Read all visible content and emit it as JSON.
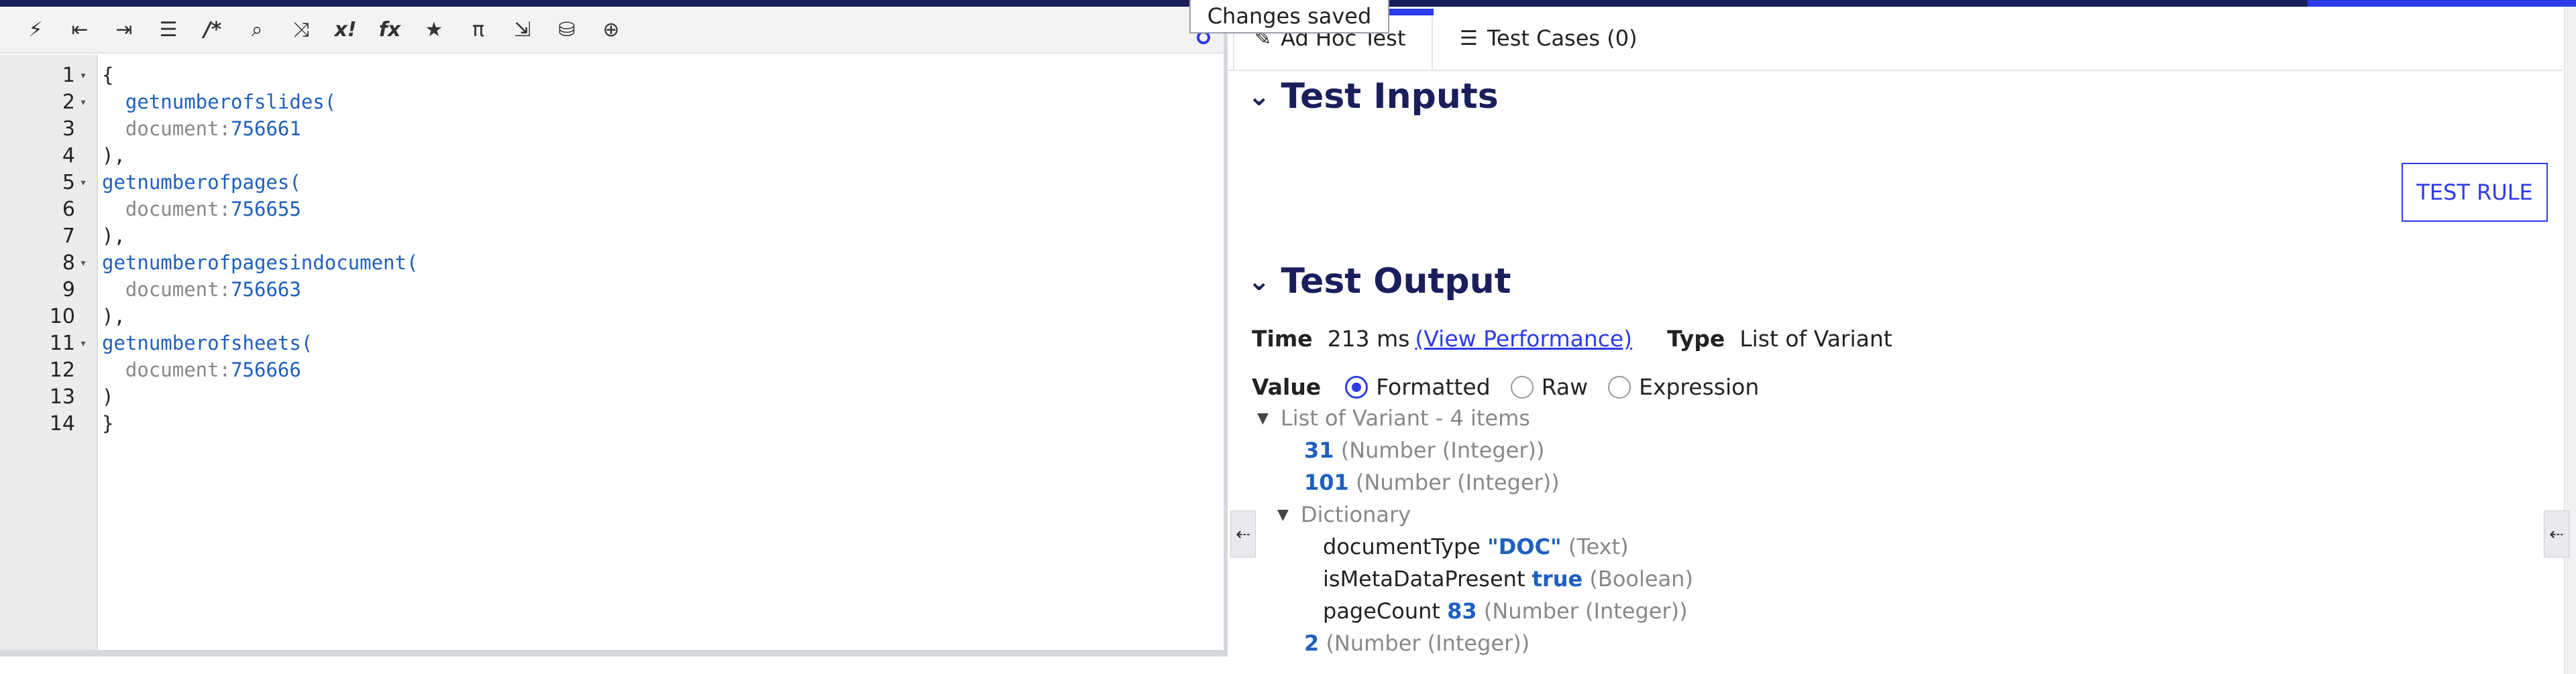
{
  "toast": {
    "text": "Changes saved"
  },
  "toolbar": {
    "icons": [
      {
        "name": "magic-wand-icon",
        "glyph": "⚡"
      },
      {
        "name": "outdent-icon",
        "glyph": "⇤"
      },
      {
        "name": "indent-icon",
        "glyph": "⇥"
      },
      {
        "name": "list-icon",
        "glyph": "☰"
      },
      {
        "name": "comment-icon",
        "glyph": "/*"
      },
      {
        "name": "search-icon",
        "glyph": "⌕"
      },
      {
        "name": "shuffle-icon",
        "glyph": "⤨"
      },
      {
        "name": "clear-icon",
        "glyph": "x!"
      },
      {
        "name": "function-icon",
        "glyph": "fx"
      },
      {
        "name": "star-icon",
        "glyph": "★"
      },
      {
        "name": "pi-icon",
        "glyph": "π"
      },
      {
        "name": "export-icon",
        "glyph": "⇲"
      },
      {
        "name": "database-search-icon",
        "glyph": "⛁"
      },
      {
        "name": "globe-icon",
        "glyph": "⊕"
      }
    ]
  },
  "editor": {
    "lines": [
      {
        "n": "1",
        "fold": "▾",
        "text": "{"
      },
      {
        "n": "2",
        "fold": "▾",
        "indent": "  ",
        "fn": "getnumberofslides",
        "after": "("
      },
      {
        "n": "3",
        "fold": "",
        "indent": "  ",
        "key": "document",
        "sep": ":",
        "num": "756661"
      },
      {
        "n": "4",
        "fold": "",
        "text": "),"
      },
      {
        "n": "5",
        "fold": "▾",
        "fn": "getnumberofpages",
        "after": "("
      },
      {
        "n": "6",
        "fold": "",
        "indent": "  ",
        "key": "document",
        "sep": ":",
        "num": "756655"
      },
      {
        "n": "7",
        "fold": "",
        "text": "),"
      },
      {
        "n": "8",
        "fold": "▾",
        "fn": "getnumberofpagesindocument",
        "after": "("
      },
      {
        "n": "9",
        "fold": "",
        "indent": "  ",
        "key": "document",
        "sep": ":",
        "num": "756663"
      },
      {
        "n": "10",
        "fold": "",
        "text": "),"
      },
      {
        "n": "11",
        "fold": "▾",
        "fn": "getnumberofsheets",
        "after": "("
      },
      {
        "n": "12",
        "fold": "",
        "indent": "  ",
        "key": "document",
        "sep": ":",
        "num": "756666"
      },
      {
        "n": "13",
        "fold": "",
        "text": ")"
      },
      {
        "n": "14",
        "fold": "",
        "text": "}"
      }
    ]
  },
  "tabs": [
    {
      "label": "Ad Hoc Test",
      "icon": "edit-icon",
      "glyph": "✎"
    },
    {
      "label": "Test Cases (0)",
      "icon": "list-icon",
      "glyph": "☰"
    }
  ],
  "test_inputs": {
    "heading": "Test Inputs",
    "chevron": "⌄",
    "button": "TEST RULE"
  },
  "test_output": {
    "heading": "Test Output",
    "chevron": "⌄",
    "time_label": "Time",
    "time_value": "213 ms",
    "view_performance": "(View Performance)",
    "type_label": "Type",
    "type_value": "List of Variant",
    "value_label": "Value",
    "options": [
      "Formatted",
      "Raw",
      "Expression"
    ],
    "selected": "Formatted"
  },
  "result_tree": {
    "root": "List of Variant - 4 items",
    "items": [
      {
        "value": "31",
        "type": " (Number (Integer))"
      },
      {
        "value": "101",
        "type": " (Number (Integer))"
      }
    ],
    "dictionary": {
      "label": "Dictionary",
      "entries": [
        {
          "key": "documentType ",
          "value": "\"DOC\"",
          "type": " (Text)"
        },
        {
          "key": "isMetaDataPresent ",
          "value": "true",
          "type": " (Boolean)"
        },
        {
          "key": "pageCount ",
          "value": "83",
          "type": " (Number (Integer))"
        }
      ]
    },
    "last": {
      "value": "2",
      "type": " (Number (Integer))"
    }
  },
  "side_arrows": {
    "left": "⇠",
    "right": "⇠"
  }
}
